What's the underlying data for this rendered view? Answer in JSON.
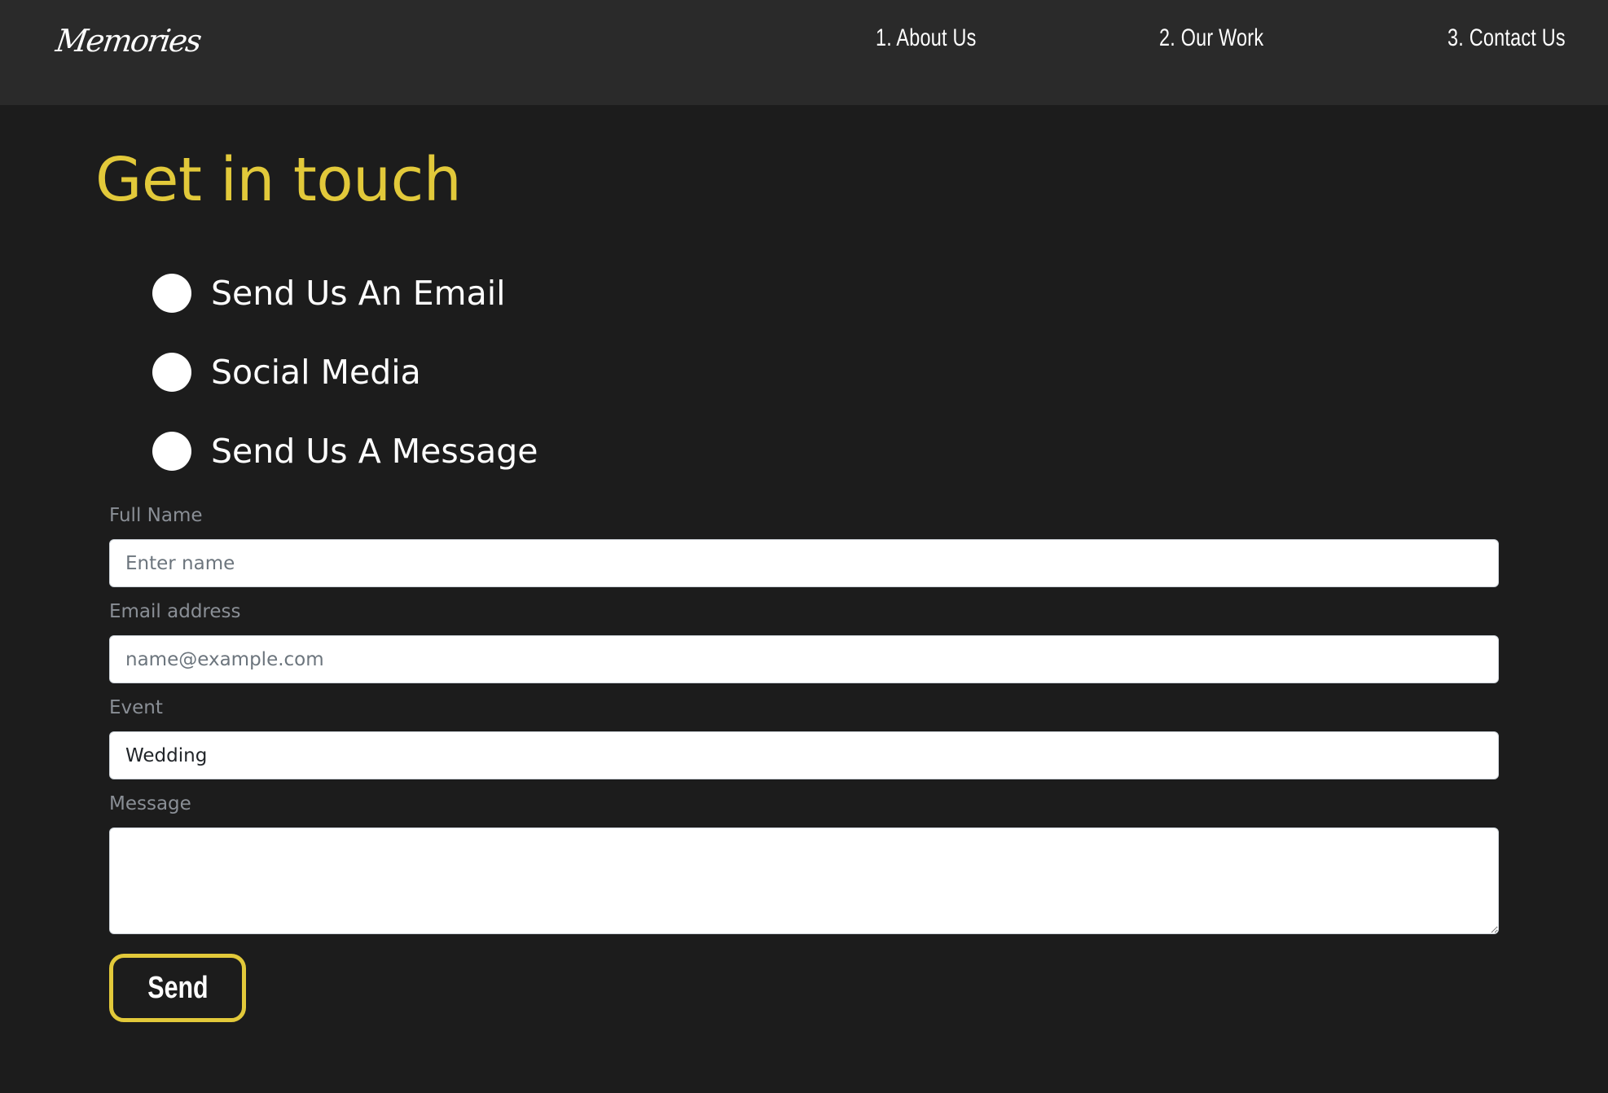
{
  "header": {
    "logo_text": "Memories",
    "nav": [
      {
        "label": "1. About Us"
      },
      {
        "label": "2. Our Work"
      },
      {
        "label": "3. Contact Us"
      }
    ]
  },
  "main": {
    "title": "Get in touch",
    "options": [
      {
        "label": "Send Us An Email"
      },
      {
        "label": "Social Media"
      },
      {
        "label": "Send Us A Message"
      }
    ],
    "form": {
      "full_name": {
        "label": "Full Name",
        "placeholder": "Enter name",
        "value": ""
      },
      "email": {
        "label": "Email address",
        "placeholder": "name@example.com",
        "value": ""
      },
      "event": {
        "label": "Event",
        "value": "Wedding"
      },
      "message": {
        "label": "Message",
        "value": ""
      },
      "send_label": "Send"
    }
  },
  "colors": {
    "accent": "#e2c93a",
    "background": "#1c1c1c",
    "header_background": "#2a2a2a"
  }
}
